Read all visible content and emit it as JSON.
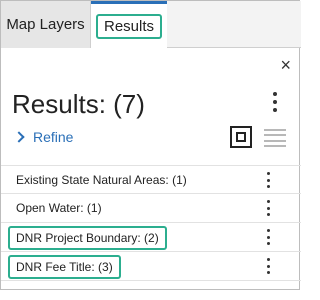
{
  "tabs": {
    "map_layers": "Map Layers",
    "results": "Results"
  },
  "panel": {
    "title": "Results: (7)",
    "refine_label": "Refine",
    "close_glyph": "×"
  },
  "results": [
    {
      "label": "Existing State Natural Areas: (1)",
      "highlighted": false
    },
    {
      "label": "Open Water: (1)",
      "highlighted": false
    },
    {
      "label": "DNR Project Boundary: (2)",
      "highlighted": true
    },
    {
      "label": "DNR Fee Title: (3)",
      "highlighted": true
    }
  ],
  "icons": {
    "close": "close-icon",
    "kebab": "more-vertical-icon",
    "refine": "chevron-right-icon",
    "card_view": "card-view-icon",
    "list_view": "list-view-icon"
  },
  "colors": {
    "accent_blue": "#2a6fb7",
    "highlight_teal": "#2cae8f"
  }
}
